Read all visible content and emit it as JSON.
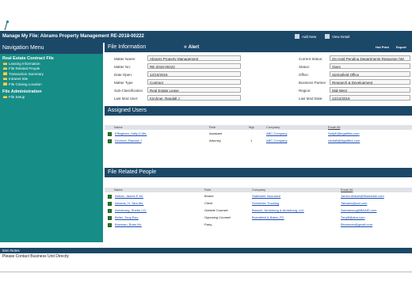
{
  "window": {
    "title": "Manage My File: Abrams Property Management RE-2018-00222",
    "actions": [
      "Add New",
      "View Detail"
    ]
  },
  "nav": {
    "header": "Navigation Menu",
    "sections": [
      {
        "title": "Real Estate Contract File",
        "items": [
          "Leasing Information",
          "File Related People",
          "Transaction Summary",
          "Intranet Site",
          "File Closing Location"
        ]
      },
      {
        "title": "File Administration",
        "items": [
          "File Setup"
        ]
      }
    ]
  },
  "file_info": {
    "header": "File Information",
    "alert": "Alert",
    "print_label": "Hot Print",
    "export_label": "Export",
    "left_fields": [
      {
        "label": "Matter Name:",
        "value": "Abrams Property Management"
      },
      {
        "label": "Matter No:",
        "value": "RE-2018-00222"
      },
      {
        "label": "Date Open:",
        "value": "12/10/2018"
      },
      {
        "label": "Matter Type",
        "value": "Contract"
      },
      {
        "label": "Sub-Classification",
        "value": "Real Estate Lease"
      },
      {
        "label": "Last Mod User:",
        "value": "Kirchner, Randall J"
      }
    ],
    "right_fields": [
      {
        "label": "Current Status:",
        "value": "On Hold Pending Departments Response (Wi"
      },
      {
        "label": "Status:",
        "value": "Open"
      },
      {
        "label": "Office:",
        "value": "Springfield Office"
      },
      {
        "label": "Business Partner",
        "value": "Research & Development"
      },
      {
        "label": "Region:",
        "value": "Mid-West"
      },
      {
        "label": "Last Mod Date:",
        "value": "12/12/2019"
      }
    ]
  },
  "assigned_users": {
    "header": "Assigned Users",
    "columns": [
      "Name",
      "Role",
      "Mgr",
      "Company",
      "Email All"
    ],
    "rows": [
      {
        "name": "Effingham, Sally D Ms.",
        "role": "Assistant",
        "mgr": "",
        "company": "ABC Company",
        "email": "SallyE@legalfiles.com"
      },
      {
        "name": "Kirchner, Randall J",
        "role": "Attorney",
        "mgr": "1",
        "company": "ABC Company",
        "email": "randall@legalfiles.com"
      }
    ]
  },
  "related_people": {
    "header": "File Related People",
    "columns": [
      "Name",
      "Role",
      "Company",
      "Email All"
    ],
    "rows": [
      {
        "name": "Abbott, James E Mr.",
        "role": "Broker",
        "company": "Statewide Insurance",
        "email": "James.Abbott@Statewide.com"
      },
      {
        "name": "Abrams, H. Tara Ms.",
        "role": "Client",
        "company": "Schneider Trucking",
        "email": "Tabrams@aol.com"
      },
      {
        "name": "Armstrong, Sheila J.D.",
        "role": "Outside Counsel",
        "company": "Bausch, Armstrong & Armstrong, Ltd.",
        "email": "Sarmstrong@BAAID.com"
      },
      {
        "name": "Beller, Tony Esq.",
        "role": "Opposing Counsel",
        "company": "Burnsfield & Baker, PC",
        "email": "TonyB@aba.com"
      },
      {
        "name": "Bowman, Brian Mr.",
        "role": "Party",
        "company": "",
        "email": "Bbowman@gmail.com"
      }
    ]
  },
  "notes": {
    "header": "Item Notes",
    "text": "Please Contact Business Unit Directly"
  },
  "colors": {
    "header_navy": "#1c4867",
    "nav_teal": "#168d86",
    "link_blue": "#1a4fb4"
  }
}
